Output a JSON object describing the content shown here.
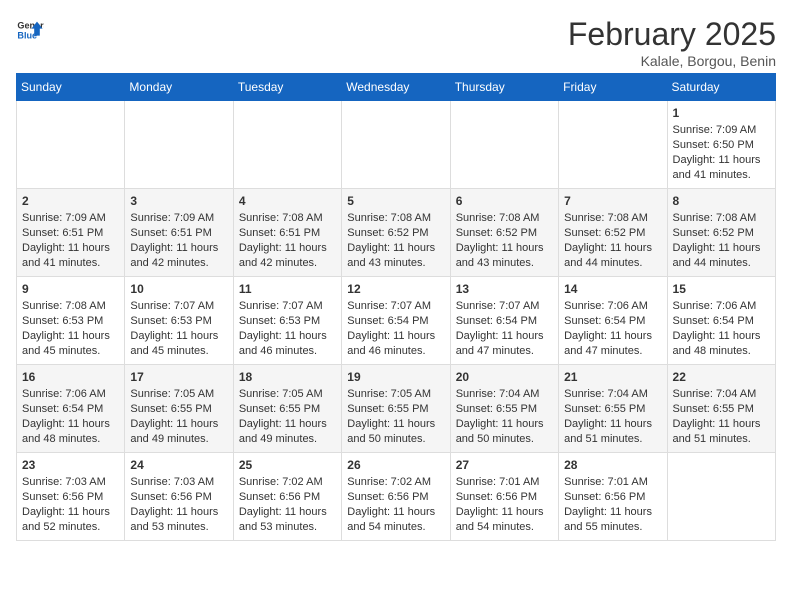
{
  "header": {
    "logo_line1": "General",
    "logo_line2": "Blue",
    "month_year": "February 2025",
    "location": "Kalale, Borgou, Benin"
  },
  "days_of_week": [
    "Sunday",
    "Monday",
    "Tuesday",
    "Wednesday",
    "Thursday",
    "Friday",
    "Saturday"
  ],
  "weeks": [
    [
      {
        "day": "",
        "info": ""
      },
      {
        "day": "",
        "info": ""
      },
      {
        "day": "",
        "info": ""
      },
      {
        "day": "",
        "info": ""
      },
      {
        "day": "",
        "info": ""
      },
      {
        "day": "",
        "info": ""
      },
      {
        "day": "1",
        "info": "Sunrise: 7:09 AM\nSunset: 6:50 PM\nDaylight: 11 hours and 41 minutes."
      }
    ],
    [
      {
        "day": "2",
        "info": "Sunrise: 7:09 AM\nSunset: 6:51 PM\nDaylight: 11 hours and 41 minutes."
      },
      {
        "day": "3",
        "info": "Sunrise: 7:09 AM\nSunset: 6:51 PM\nDaylight: 11 hours and 42 minutes."
      },
      {
        "day": "4",
        "info": "Sunrise: 7:08 AM\nSunset: 6:51 PM\nDaylight: 11 hours and 42 minutes."
      },
      {
        "day": "5",
        "info": "Sunrise: 7:08 AM\nSunset: 6:52 PM\nDaylight: 11 hours and 43 minutes."
      },
      {
        "day": "6",
        "info": "Sunrise: 7:08 AM\nSunset: 6:52 PM\nDaylight: 11 hours and 43 minutes."
      },
      {
        "day": "7",
        "info": "Sunrise: 7:08 AM\nSunset: 6:52 PM\nDaylight: 11 hours and 44 minutes."
      },
      {
        "day": "8",
        "info": "Sunrise: 7:08 AM\nSunset: 6:52 PM\nDaylight: 11 hours and 44 minutes."
      }
    ],
    [
      {
        "day": "9",
        "info": "Sunrise: 7:08 AM\nSunset: 6:53 PM\nDaylight: 11 hours and 45 minutes."
      },
      {
        "day": "10",
        "info": "Sunrise: 7:07 AM\nSunset: 6:53 PM\nDaylight: 11 hours and 45 minutes."
      },
      {
        "day": "11",
        "info": "Sunrise: 7:07 AM\nSunset: 6:53 PM\nDaylight: 11 hours and 46 minutes."
      },
      {
        "day": "12",
        "info": "Sunrise: 7:07 AM\nSunset: 6:54 PM\nDaylight: 11 hours and 46 minutes."
      },
      {
        "day": "13",
        "info": "Sunrise: 7:07 AM\nSunset: 6:54 PM\nDaylight: 11 hours and 47 minutes."
      },
      {
        "day": "14",
        "info": "Sunrise: 7:06 AM\nSunset: 6:54 PM\nDaylight: 11 hours and 47 minutes."
      },
      {
        "day": "15",
        "info": "Sunrise: 7:06 AM\nSunset: 6:54 PM\nDaylight: 11 hours and 48 minutes."
      }
    ],
    [
      {
        "day": "16",
        "info": "Sunrise: 7:06 AM\nSunset: 6:54 PM\nDaylight: 11 hours and 48 minutes."
      },
      {
        "day": "17",
        "info": "Sunrise: 7:05 AM\nSunset: 6:55 PM\nDaylight: 11 hours and 49 minutes."
      },
      {
        "day": "18",
        "info": "Sunrise: 7:05 AM\nSunset: 6:55 PM\nDaylight: 11 hours and 49 minutes."
      },
      {
        "day": "19",
        "info": "Sunrise: 7:05 AM\nSunset: 6:55 PM\nDaylight: 11 hours and 50 minutes."
      },
      {
        "day": "20",
        "info": "Sunrise: 7:04 AM\nSunset: 6:55 PM\nDaylight: 11 hours and 50 minutes."
      },
      {
        "day": "21",
        "info": "Sunrise: 7:04 AM\nSunset: 6:55 PM\nDaylight: 11 hours and 51 minutes."
      },
      {
        "day": "22",
        "info": "Sunrise: 7:04 AM\nSunset: 6:55 PM\nDaylight: 11 hours and 51 minutes."
      }
    ],
    [
      {
        "day": "23",
        "info": "Sunrise: 7:03 AM\nSunset: 6:56 PM\nDaylight: 11 hours and 52 minutes."
      },
      {
        "day": "24",
        "info": "Sunrise: 7:03 AM\nSunset: 6:56 PM\nDaylight: 11 hours and 53 minutes."
      },
      {
        "day": "25",
        "info": "Sunrise: 7:02 AM\nSunset: 6:56 PM\nDaylight: 11 hours and 53 minutes."
      },
      {
        "day": "26",
        "info": "Sunrise: 7:02 AM\nSunset: 6:56 PM\nDaylight: 11 hours and 54 minutes."
      },
      {
        "day": "27",
        "info": "Sunrise: 7:01 AM\nSunset: 6:56 PM\nDaylight: 11 hours and 54 minutes."
      },
      {
        "day": "28",
        "info": "Sunrise: 7:01 AM\nSunset: 6:56 PM\nDaylight: 11 hours and 55 minutes."
      },
      {
        "day": "",
        "info": ""
      }
    ]
  ]
}
